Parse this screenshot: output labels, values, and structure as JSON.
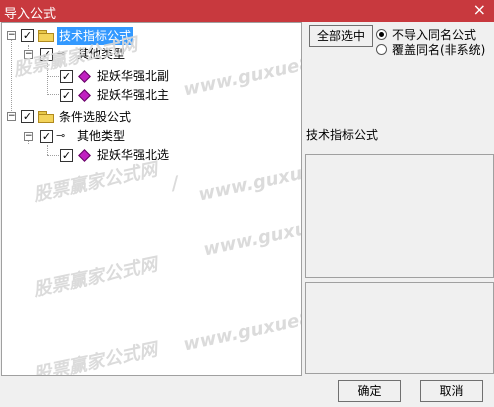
{
  "window": {
    "title": "导入公式",
    "close_glyph": "×"
  },
  "tree": {
    "nodes": [
      {
        "label": "技术指标公式",
        "level": 0,
        "type": "folder",
        "checked": true,
        "selected": true
      },
      {
        "label": "其他类型",
        "level": 1,
        "type": "key",
        "checked": true
      },
      {
        "label": "捉妖华强北副",
        "level": 2,
        "type": "formula",
        "checked": true
      },
      {
        "label": "捉妖华强北主",
        "level": 2,
        "type": "formula",
        "checked": true
      },
      {
        "label": "条件选股公式",
        "level": 0,
        "type": "folder",
        "checked": true
      },
      {
        "label": "其他类型",
        "level": 1,
        "type": "key",
        "checked": true
      },
      {
        "label": "捉妖华强北选",
        "level": 2,
        "type": "formula",
        "checked": true
      }
    ],
    "check_glyph": "✓",
    "expand_glyph": "−"
  },
  "right": {
    "select_all_label": "全部选中",
    "radio_options": [
      {
        "label": "不导入同名公式",
        "checked": true
      },
      {
        "label": "覆盖同名(非系统)",
        "checked": false
      }
    ],
    "info_title": "技术指标公式"
  },
  "footer": {
    "ok_label": "确定",
    "cancel_label": "取消"
  },
  "watermark": {
    "text_cn": "股票赢家公式网",
    "text_en": "www.guxue8.cn",
    "sep": "/"
  }
}
